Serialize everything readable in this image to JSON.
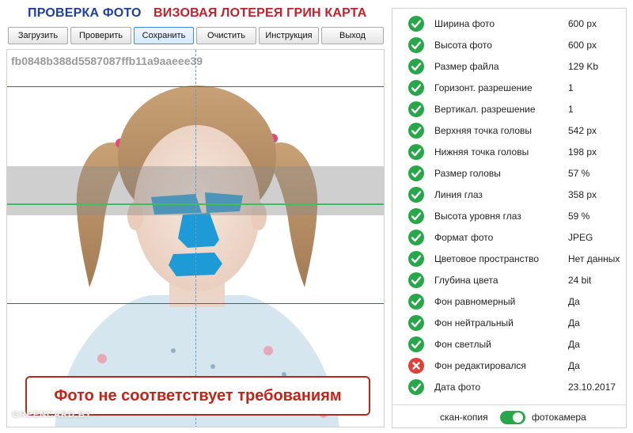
{
  "header": {
    "title_left": "ПРОВЕРКА ФОТО",
    "title_right": "ВИЗОВАЯ ЛОТЕРЕЯ ГРИН КАРТА"
  },
  "toolbar": {
    "buttons": [
      {
        "label": "Загрузить"
      },
      {
        "label": "Проверить"
      },
      {
        "label": "Сохранить"
      },
      {
        "label": "Очистить"
      },
      {
        "label": "Инструкция"
      },
      {
        "label": "Выход"
      }
    ]
  },
  "photo": {
    "hash": "fb0848b388d5587087ffb11a9aaeee39",
    "warning": "Фото не соответствует требованиям",
    "watermark": "GREENCARD.BY"
  },
  "checks": [
    {
      "label": "Ширина фото",
      "value": "600 px",
      "status": "ok"
    },
    {
      "label": "Высота фото",
      "value": "600 px",
      "status": "ok"
    },
    {
      "label": "Размер файла",
      "value": "129 Kb",
      "status": "ok"
    },
    {
      "label": "Горизонт. разрешение",
      "value": "1",
      "status": "ok"
    },
    {
      "label": "Вертикал. разрешение",
      "value": "1",
      "status": "ok"
    },
    {
      "label": "Верхняя точка головы",
      "value": "542 px",
      "status": "ok"
    },
    {
      "label": "Нижняя точка головы",
      "value": "198 px",
      "status": "ok"
    },
    {
      "label": "Размер головы",
      "value": "57 %",
      "status": "ok"
    },
    {
      "label": "Линия глаз",
      "value": "358 px",
      "status": "ok"
    },
    {
      "label": "Высота уровня глаз",
      "value": "59 %",
      "status": "ok"
    },
    {
      "label": "Формат фото",
      "value": "JPEG",
      "status": "ok"
    },
    {
      "label": "Цветовое пространство",
      "value": "Нет данных",
      "status": "ok"
    },
    {
      "label": "Глубина цвета",
      "value": "24 bit",
      "status": "ok"
    },
    {
      "label": "Фон равномерный",
      "value": "Да",
      "status": "ok"
    },
    {
      "label": "Фон нейтральный",
      "value": "Да",
      "status": "ok"
    },
    {
      "label": "Фон светлый",
      "value": "Да",
      "status": "ok"
    },
    {
      "label": "Фон редактировался",
      "value": "Да",
      "status": "fail"
    },
    {
      "label": "Дата фото",
      "value": "23.10.2017",
      "status": "ok"
    }
  ],
  "mode_toggle": {
    "left_label": "скан-копия",
    "right_label": "фотокамера",
    "on": true
  },
  "colors": {
    "title_blue": "#1f3f9e",
    "title_red": "#c4202a",
    "ok_green": "#28a74a",
    "fail_red": "#e0403a",
    "warn_red": "#c1251a",
    "mask_blue": "#1e9bd7"
  },
  "icons": {
    "ok": "check-circle-icon",
    "fail": "x-circle-icon"
  }
}
